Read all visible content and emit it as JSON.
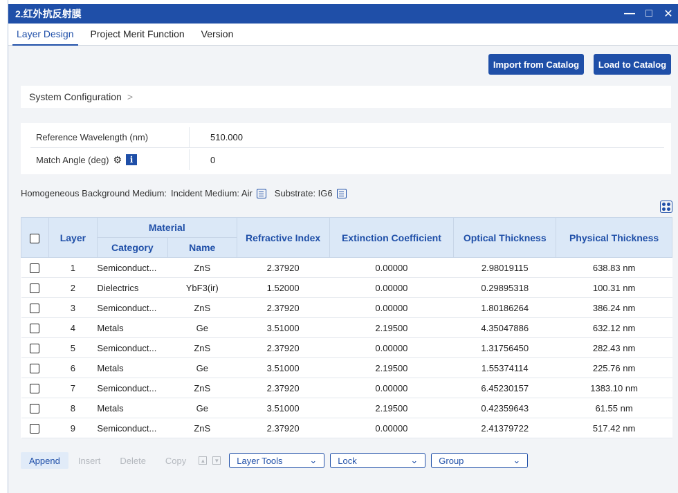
{
  "window": {
    "title": "2.红外抗反射膜",
    "min": "—",
    "max": "□",
    "close": "✕"
  },
  "tabs": [
    "Layer Design",
    "Project Merit Function",
    "Version"
  ],
  "toolbar": {
    "import_label": "Import from Catalog",
    "load_label": "Load to Catalog"
  },
  "system_config": {
    "label": "System Configuration",
    "chevron": ">"
  },
  "params": {
    "ref_wavelength_label": "Reference Wavelength (nm)",
    "ref_wavelength_value": "510.000",
    "match_angle_label": "Match Angle (deg)",
    "match_angle_value": "0",
    "info_glyph": "i"
  },
  "medium": {
    "label": "Homogeneous Background Medium:",
    "incident": "Incident Medium: Air",
    "substrate": "Substrate: IG6"
  },
  "table": {
    "headers": {
      "layer": "Layer",
      "material": "Material",
      "category": "Category",
      "name": "Name",
      "refractive_index": "Refractive Index",
      "extinction": "Extinction Coefficient",
      "optical": "Optical Thickness",
      "physical": "Physical Thickness"
    },
    "rows": [
      {
        "layer": "1",
        "category": "Semiconduct...",
        "name": "ZnS",
        "n": "2.37920",
        "k": "0.00000",
        "optical": "2.98019115",
        "physical": "638.83 nm"
      },
      {
        "layer": "2",
        "category": "Dielectrics",
        "name": "YbF3(ir)",
        "n": "1.52000",
        "k": "0.00000",
        "optical": "0.29895318",
        "physical": "100.31 nm"
      },
      {
        "layer": "3",
        "category": "Semiconduct...",
        "name": "ZnS",
        "n": "2.37920",
        "k": "0.00000",
        "optical": "1.80186264",
        "physical": "386.24 nm"
      },
      {
        "layer": "4",
        "category": "Metals",
        "name": "Ge",
        "n": "3.51000",
        "k": "2.19500",
        "optical": "4.35047886",
        "physical": "632.12 nm"
      },
      {
        "layer": "5",
        "category": "Semiconduct...",
        "name": "ZnS",
        "n": "2.37920",
        "k": "0.00000",
        "optical": "1.31756450",
        "physical": "282.43 nm"
      },
      {
        "layer": "6",
        "category": "Metals",
        "name": "Ge",
        "n": "3.51000",
        "k": "2.19500",
        "optical": "1.55374114",
        "physical": "225.76 nm"
      },
      {
        "layer": "7",
        "category": "Semiconduct...",
        "name": "ZnS",
        "n": "2.37920",
        "k": "0.00000",
        "optical": "6.45230157",
        "physical": "1383.10 nm"
      },
      {
        "layer": "8",
        "category": "Metals",
        "name": "Ge",
        "n": "3.51000",
        "k": "2.19500",
        "optical": "0.42359643",
        "physical": "61.55 nm"
      },
      {
        "layer": "9",
        "category": "Semiconduct...",
        "name": "ZnS",
        "n": "2.37920",
        "k": "0.00000",
        "optical": "2.41379722",
        "physical": "517.42 nm"
      }
    ]
  },
  "bottom": {
    "append": "Append",
    "insert": "Insert",
    "delete": "Delete",
    "copy": "Copy",
    "layer_tools": "Layer Tools",
    "lock": "Lock",
    "group": "Group"
  },
  "colors": {
    "accent": "#1f4fa8",
    "header_bg": "#dbe8f7"
  }
}
